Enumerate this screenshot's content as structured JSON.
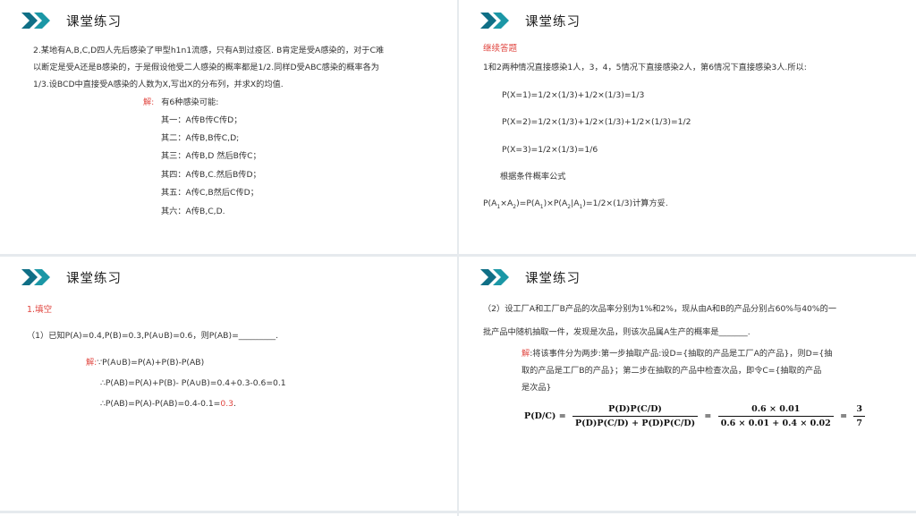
{
  "slides": [
    {
      "title": "课堂练习",
      "problem": [
        "2.某地有A,B,C,D四人先后感染了甲型h1n1流感，只有A到过疫区. B肯定是受A感染的，对于C难",
        "以断定是受A还是B感染的，于是假设他受二人感染的概率都是1/2.同样D受ABC感染的概率各为",
        "1/3.设BCD中直接受A感染的人数为X,写出X的分布列，并求X的均值."
      ],
      "answer_label": "解:",
      "answer_intro": "有6种感染可能:",
      "cases": [
        "其一：A传B传C传D；",
        "其二：A传B,B传C,D;",
        "其三：A传B,D 然后B传C；",
        "其四：A传B,C.然后B传D；",
        "其五：A传C,B然后C传D；",
        "其六：A传B,C,D."
      ]
    },
    {
      "title": "课堂练习",
      "subtitle": "继续答题",
      "intro": "1和2两种情况直接感染1人，3，4，5情况下直接感染2人，第6情况下直接感染3人.所以:",
      "eqs": [
        "P(X=1)=1/2×(1/3)+1/2×(1/3)=1/3",
        "P(X=2)=1/2×(1/3)+1/2×(1/3)+1/2×(1/3)=1/2",
        "P(X=3)=1/2×(1/3)=1/6"
      ],
      "note": "根据条件概率公式",
      "final_a": "P(A",
      "final_b": "×A",
      "final_c": ")=P(A",
      "final_d": ")×P(A",
      "final_e": "|A",
      "final_f": ")=1/2×(1/3)计算方妥.",
      "sub1": "1",
      "sub2": "2"
    },
    {
      "title": "课堂练习",
      "label": "1.填空",
      "question": "（1）已知P(A)=0.4,P(B)=0.3,P(A∪B)=0.6，则P(AB)=_________.",
      "sol_label": "解:",
      "sol1": "∵P(A∪B)=P(A)+P(B)-P(AB)",
      "sol2": "∴P(AB)=P(A)+P(B)- P(A∪B)=0.4+0.3-0.6=0.1",
      "sol3_a": "∴P(AB)=P(A)-P(AB)=0.4-0.1=",
      "sol3_b": "0.3",
      "sol3_c": "."
    },
    {
      "title": "课堂练习",
      "q1": "（2）设工厂A和工厂B产品的次品率分别为1%和2%，现从由A和B的产品分别占60%与40%的一",
      "q2": "批产品中随机抽取一件，发现是次品，则该次品属A生产的概率是_______.",
      "sol_label": "解",
      "sol1": ":将该事件分为两步:第一步抽取产品:设D={抽取的产品是工厂A的产品}，则D={抽",
      "sol2": "取的产品是工厂B的产品}；第二步在抽取的产品中检查次品，即令C={抽取的产品",
      "sol3": "是次品}",
      "formula": {
        "lhs": "P(D/C) =",
        "f1_num": "P(D)P(C/D)",
        "f1_den": "P(D)P(C/D) + P(D)P(C/D)",
        "eq": "=",
        "f2_num": "0.6 × 0.01",
        "f2_den": "0.6 × 0.01 + 0.4 × 0.02",
        "eq2": "=",
        "f3_num": "3",
        "f3_den": "7"
      }
    }
  ],
  "colors": {
    "accent": "#1b97a6",
    "accent_dark": "#0f6f86",
    "red": "#e0453f"
  }
}
